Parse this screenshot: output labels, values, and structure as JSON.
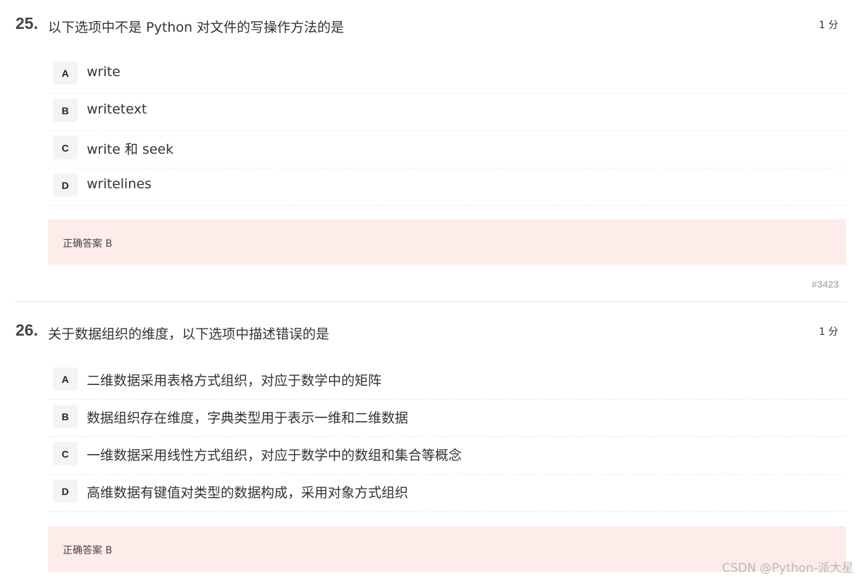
{
  "questions": [
    {
      "number": "25.",
      "title": "以下选项中不是 Python 对文件的写操作方法的是",
      "score": "1 分",
      "options": [
        {
          "letter": "A",
          "text": "write"
        },
        {
          "letter": "B",
          "text": "writetext"
        },
        {
          "letter": "C",
          "text": "write 和 seek"
        },
        {
          "letter": "D",
          "text": "writelines"
        }
      ],
      "answer": "正确答案 B",
      "id": "#3423"
    },
    {
      "number": "26.",
      "title": "关于数据组织的维度，以下选项中描述错误的是",
      "score": "1 分",
      "options": [
        {
          "letter": "A",
          "text": "二维数据采用表格方式组织，对应于数学中的矩阵"
        },
        {
          "letter": "B",
          "text": "数据组织存在维度，字典类型用于表示一维和二维数据"
        },
        {
          "letter": "C",
          "text": "一维数据采用线性方式组织，对应于数学中的数组和集合等概念"
        },
        {
          "letter": "D",
          "text": "高维数据有键值对类型的数据构成，采用对象方式组织"
        }
      ],
      "answer": "正确答案 B"
    }
  ],
  "watermark": "CSDN @Python-派大星",
  "colors": {
    "answer_bg": "#fdecea",
    "badge_bg": "#f4f4f4",
    "id_text": "#b5b5b5"
  }
}
